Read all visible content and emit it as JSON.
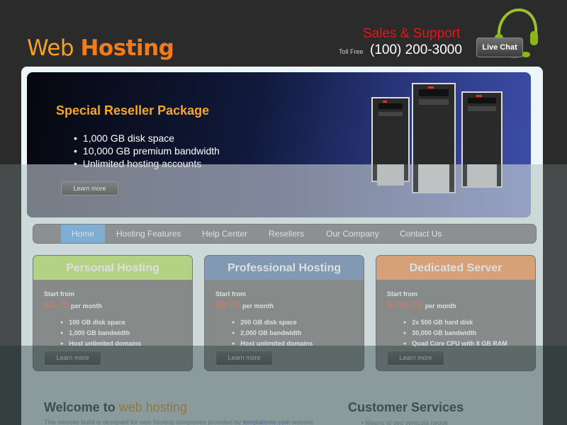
{
  "header": {
    "logo_part1": "Web",
    "logo_part2": "Hosting",
    "sales_label": "Sales & Support",
    "toll_free_label": "Toll Free",
    "phone": "(100) 200-3000",
    "live_chat_label": "Live Chat"
  },
  "banner": {
    "title": "Special Reseller Package",
    "features": [
      "1,000 GB disk space",
      "10,000 GB premium bandwidth",
      "Unlimited hosting accounts"
    ],
    "learn_more": "Learn more"
  },
  "nav": {
    "items": [
      {
        "label": "Home",
        "active": true
      },
      {
        "label": "Hosting Features"
      },
      {
        "label": "Help Center"
      },
      {
        "label": "Resellers"
      },
      {
        "label": "Our Company"
      },
      {
        "label": "Contact Us"
      }
    ]
  },
  "packages": [
    {
      "title": "Personal Hosting",
      "start_from": "Start from",
      "price": "$4.75",
      "per": "per month",
      "features": [
        "100 GB disk space",
        "1,000 GB bandwidth",
        "Host unlimited domains"
      ],
      "button": "Learn more",
      "color": "#c6ec7c"
    },
    {
      "title": "Professional Hosting",
      "start_from": "Start from",
      "price": "$9.75",
      "per": "per month",
      "features": [
        "200 GB disk space",
        "2,000 GB bandwidth",
        "Host unlimited domains"
      ],
      "button": "Learn more",
      "color": "#7e9bc2"
    },
    {
      "title": "Dedicated Server",
      "start_from": "Start from",
      "price": "$199.75",
      "per": "per month",
      "features": [
        "2x 500 GB hard disk",
        "30,000 GB bandwidth",
        "Quad Core CPU with 8 GB RAM"
      ],
      "button": "Learn more",
      "color": "#f7a56e"
    }
  ],
  "welcome": {
    "title_part1": "Welcome to",
    "title_part2": "web hosting",
    "text_part1": "This website build is designed for web hosting companies provided by",
    "link": "templatemo.com",
    "text_part2": "website"
  },
  "customer_services": {
    "title": "Customer Services",
    "first_item": "Mauris id sed vehicula neque"
  },
  "colors": {
    "accent_orange": "#f4a72b",
    "nav_active": "#79b9ef",
    "price_red": "#f26c4f",
    "sales_red": "#e8141a"
  }
}
